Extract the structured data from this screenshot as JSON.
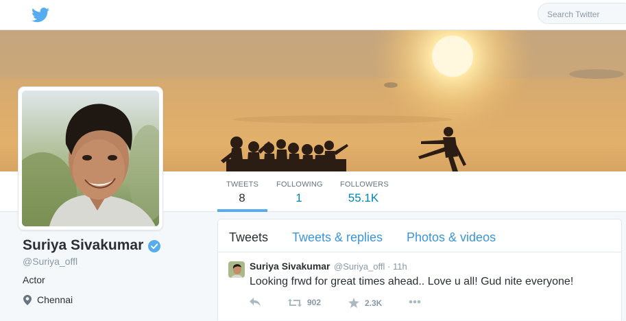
{
  "topbar": {
    "logo_icon": "twitter-bird-icon",
    "search_placeholder": "Search Twitter"
  },
  "profile": {
    "name": "Suriya Sivakumar",
    "handle": "@Suriya_offl",
    "verified": true,
    "bio": "Actor",
    "location": "Chennai"
  },
  "stats": [
    {
      "label": "TWEETS",
      "value": "8"
    },
    {
      "label": "FOLLOWING",
      "value": "1"
    },
    {
      "label": "FOLLOWERS",
      "value": "55.1K"
    }
  ],
  "timeline": {
    "tabs": [
      {
        "label": "Tweets"
      },
      {
        "label": "Tweets & replies"
      },
      {
        "label": "Photos & videos"
      }
    ]
  },
  "tweet": {
    "author": "Suriya Sivakumar",
    "handle": "@Suriya_offl",
    "time": "· 11h",
    "text": "Looking frwd for great times ahead.. Love u all! Gud nite everyone!",
    "retweets": "902",
    "favorites": "2.3K"
  },
  "colors": {
    "accent": "#55acee",
    "link": "#3b94d9",
    "stat_value": "#0084b4"
  }
}
